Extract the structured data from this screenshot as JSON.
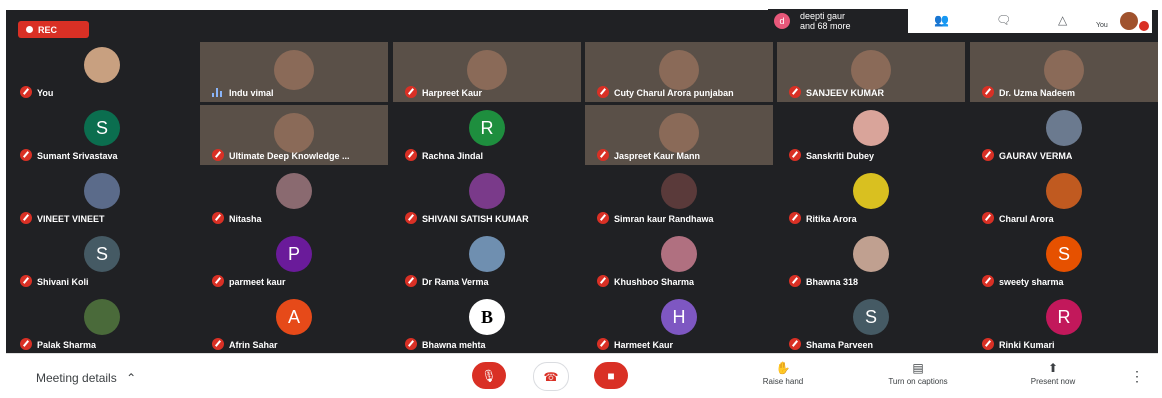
{
  "recording": {
    "label": "REC"
  },
  "topbar": {
    "participant_initial": "d",
    "participant_summary": "deepti gaur\nand 68 more",
    "you_label": "You",
    "people_icon": "people-icon",
    "chat_icon": "chat-icon",
    "activities_icon": "activities-icon"
  },
  "participants": [
    {
      "name": "You",
      "kind": "photo",
      "color": "#c8a080"
    },
    {
      "name": "Indu vimal",
      "kind": "video",
      "speaking": true
    },
    {
      "name": "Harpreet Kaur",
      "kind": "video"
    },
    {
      "name": "Cuty Charul Arora punjaban",
      "kind": "video"
    },
    {
      "name": "SANJEEV KUMAR",
      "kind": "video"
    },
    {
      "name": "Dr. Uzma Nadeem",
      "kind": "video"
    },
    {
      "name": "Sumant Srivastava",
      "kind": "letter",
      "letter": "S",
      "color": "#0b6e4f"
    },
    {
      "name": "Ultimate Deep Knowledge ...",
      "kind": "video"
    },
    {
      "name": "Rachna Jindal",
      "kind": "letter",
      "letter": "R",
      "color": "#1e8e3e"
    },
    {
      "name": "Jaspreet Kaur Mann",
      "kind": "video"
    },
    {
      "name": "Sanskriti Dubey",
      "kind": "photo",
      "color": "#d9a49a"
    },
    {
      "name": "GAURAV VERMA",
      "kind": "photo",
      "color": "#6b7a8f"
    },
    {
      "name": "VINEET VINEET",
      "kind": "photo",
      "color": "#5b6b8a"
    },
    {
      "name": "Nitasha",
      "kind": "photo",
      "color": "#8a6a70"
    },
    {
      "name": "SHIVANI SATISH KUMAR",
      "kind": "photo",
      "color": "#7a3a8a"
    },
    {
      "name": "Simran kaur Randhawa",
      "kind": "photo",
      "color": "#5a3a3a"
    },
    {
      "name": "Ritika Arora",
      "kind": "photo",
      "color": "#d9c020"
    },
    {
      "name": "Charul Arora",
      "kind": "photo",
      "color": "#c05a20"
    },
    {
      "name": "Shivani Koli",
      "kind": "letter",
      "letter": "S",
      "color": "#455a64"
    },
    {
      "name": "parmeet kaur",
      "kind": "letter",
      "letter": "P",
      "color": "#6a1b9a"
    },
    {
      "name": "Dr Rama Verma",
      "kind": "photo",
      "color": "#6f8fb0"
    },
    {
      "name": "Khushboo Sharma",
      "kind": "photo",
      "color": "#b07080"
    },
    {
      "name": "Bhawna 318",
      "kind": "photo",
      "color": "#c0a090"
    },
    {
      "name": "sweety sharma",
      "kind": "letter",
      "letter": "S",
      "color": "#e65100"
    },
    {
      "name": "Palak Sharma",
      "kind": "photo",
      "color": "#4a6a3a"
    },
    {
      "name": "Afrin Sahar",
      "kind": "letter",
      "letter": "A",
      "color": "#e64a19"
    },
    {
      "name": "Bhawna mehta",
      "kind": "letter",
      "letter": "B",
      "color": "#ffffff",
      "textcolor": "#000000"
    },
    {
      "name": "Harmeet Kaur",
      "kind": "letter",
      "letter": "H",
      "color": "#7e57c2"
    },
    {
      "name": "Shama Parveen",
      "kind": "letter",
      "letter": "S",
      "color": "#455a64"
    },
    {
      "name": "Rinki Kumari",
      "kind": "letter",
      "letter": "R",
      "color": "#c2185b"
    }
  ],
  "bottombar": {
    "meeting_details": "Meeting details",
    "raise_hand": "Raise hand",
    "captions": "Turn on captions",
    "present": "Present now"
  },
  "colors": {
    "danger": "#d93025",
    "stage": "#202124"
  }
}
